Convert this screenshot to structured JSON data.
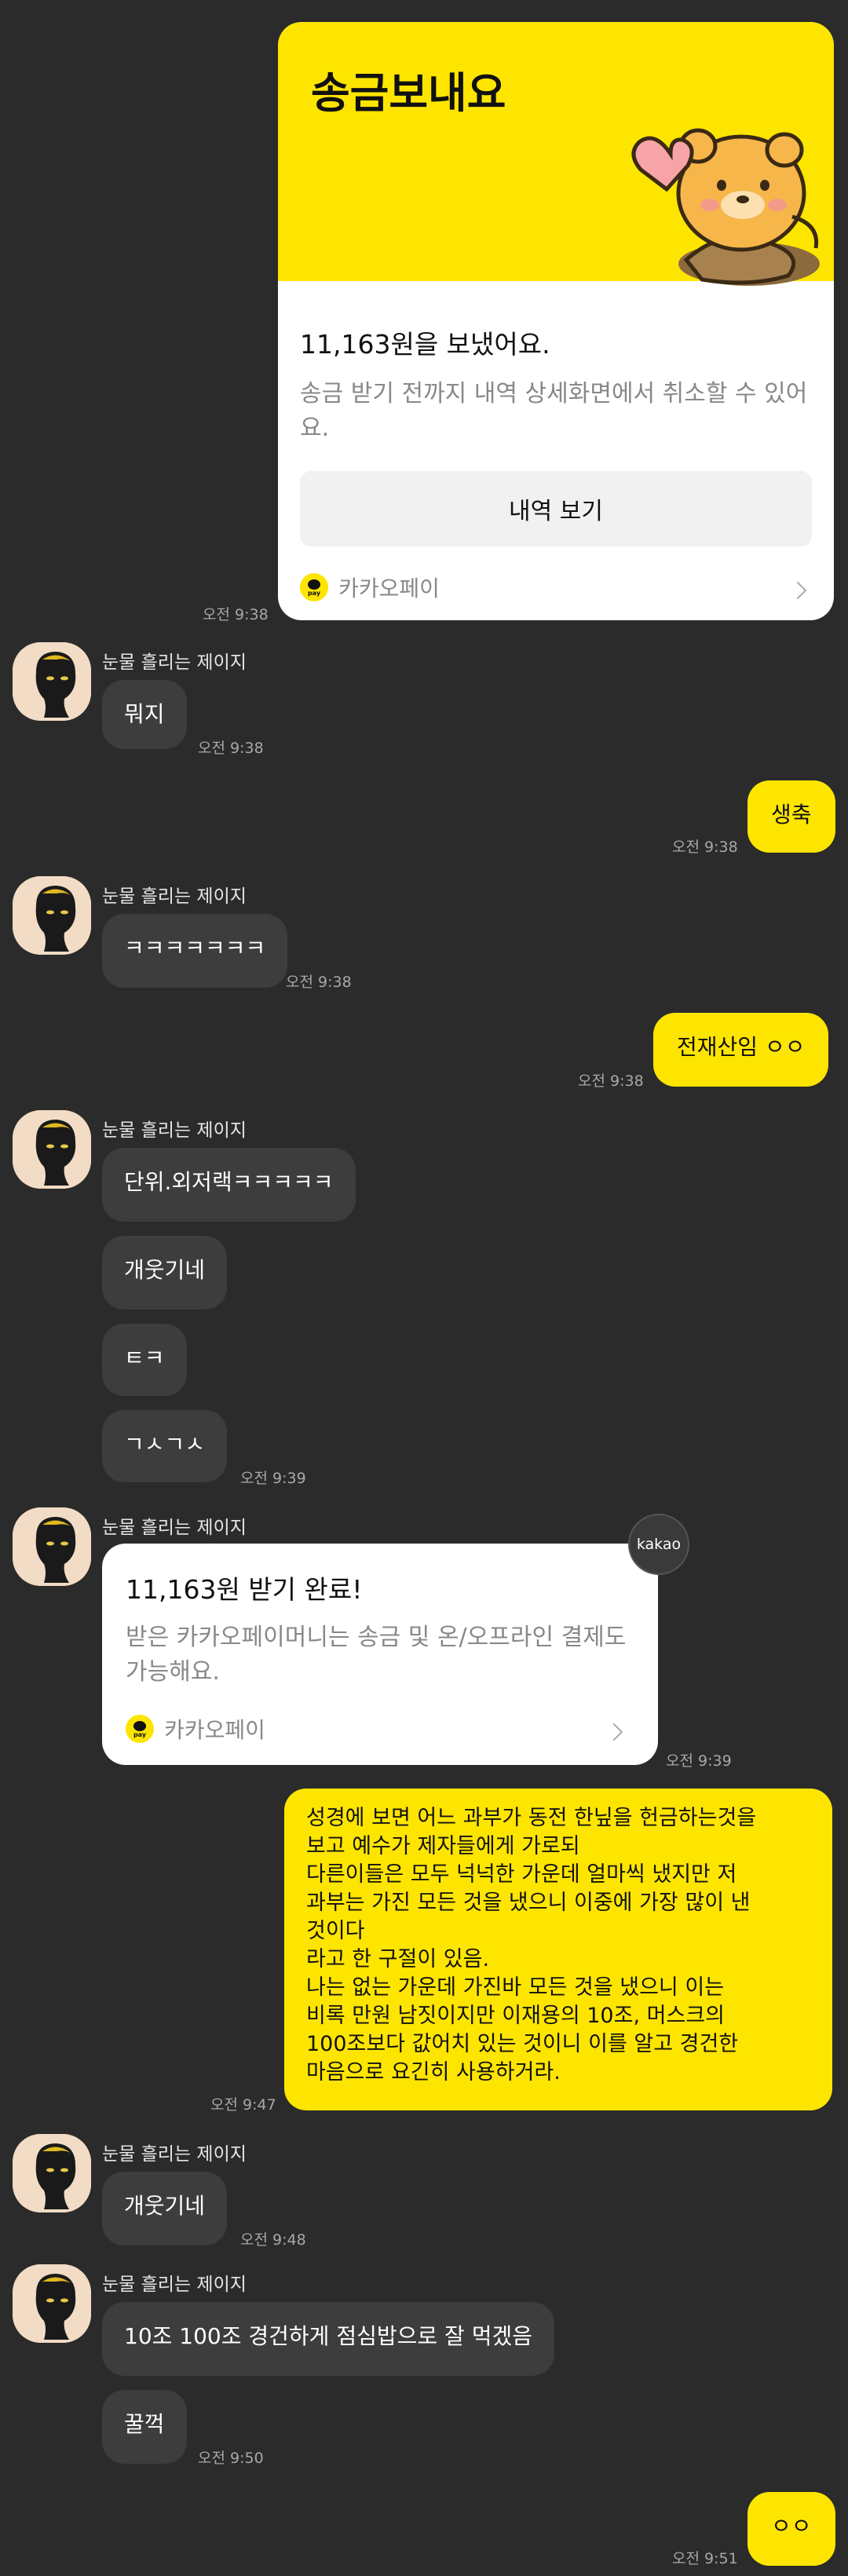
{
  "send_card": {
    "header_title": "송금보내요",
    "amount_text": "11,163원을 보냈어요.",
    "desc": "송금 받기 전까지 내역 상세화면에서 취소할 수 있어요.",
    "button_label": "내역 보기",
    "brand": "카카오페이",
    "time": "오전 9:38"
  },
  "receive_card": {
    "title": "11,163원 받기 완료!",
    "desc": "받은 카카오페이머니는 송금 및 온/오프라인 결제도 가능해요.",
    "brand": "카카오페이",
    "badge": "kakao",
    "time": "오전 9:39"
  },
  "sender_name": "눈물 흘리는 제이지",
  "messages": {
    "m1": {
      "text": "뭐지",
      "time": "오전 9:38"
    },
    "m2": {
      "text": "생축",
      "time": "오전 9:38"
    },
    "m3": {
      "text": "ㅋㅋㅋㅋㅋㅋㅋ",
      "time": "오전 9:38"
    },
    "m4": {
      "text": "전재산임 ㅇㅇ",
      "time": "오전 9:38"
    },
    "m5": {
      "text": "단위.외저랙ㅋㅋㅋㅋㅋ"
    },
    "m6": {
      "text": "개웃기네"
    },
    "m7": {
      "text": "ㅌㅋ"
    },
    "m8": {
      "text": "ㄱㅅㄱㅅ",
      "time": "오전 9:39"
    },
    "m9": {
      "lines": [
        "성경에 보면 어느 과부가 동전 한닢을 헌금하는것을",
        "보고 예수가 제자들에게 가로되",
        "다른이들은 모두 넉넉한 가운데 얼마씩 냈지만 저",
        "과부는 가진 모든 것을 냈으니 이중에 가장 많이 낸",
        "것이다",
        "라고 한 구절이 있음.",
        "나는 없는 가운데 가진바 모든 것을 냈으니 이는",
        "비록 만원 남짓이지만 이재용의 10조, 머스크의",
        "100조보다 값어치 있는 것이니 이를 알고 경건한",
        "마음으로 요긴히 사용하거라."
      ],
      "time": "오전 9:47"
    },
    "m10": {
      "text": "개웃기네",
      "time": "오전 9:48"
    },
    "m11": {
      "text": "10조 100조 경건하게 점심밥으로 잘 먹겠음"
    },
    "m12": {
      "text": "꿀꺽",
      "time": "오전 9:50"
    },
    "m13": {
      "text": "ㅇㅇ",
      "time": "오전 9:51"
    }
  },
  "colors": {
    "background": "#2b2b2b",
    "incoming": "#3d3d3d",
    "outgoing": "#fee500"
  }
}
